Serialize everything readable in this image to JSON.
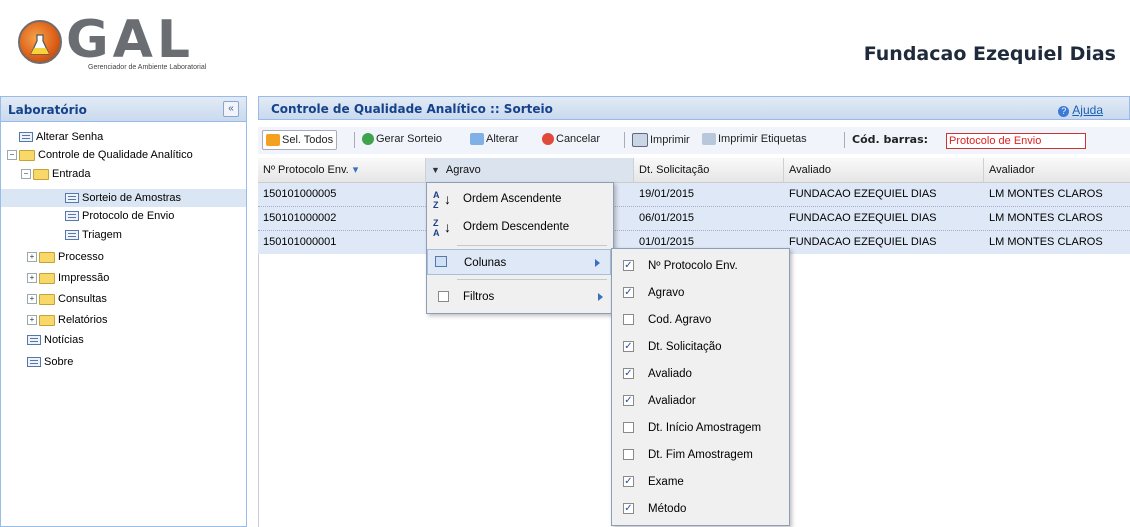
{
  "header": {
    "logo_text": "GAL",
    "logo_subtitle": "Gerenciador de Ambiente Laboratorial",
    "org_title": "Fundacao Ezequiel Dias"
  },
  "left_panel": {
    "title": "Laboratório",
    "collapse_glyph": "«",
    "items": [
      {
        "label": "Alterar Senha"
      },
      {
        "label": "Controle de Qualidade Analítico"
      },
      {
        "label": "Entrada"
      },
      {
        "label": "Sorteio de Amostras"
      },
      {
        "label": "Protocolo de Envio"
      },
      {
        "label": "Triagem"
      },
      {
        "label": "Processo"
      },
      {
        "label": "Impressão"
      },
      {
        "label": "Consultas"
      },
      {
        "label": "Relatórios"
      },
      {
        "label": "Notícias"
      },
      {
        "label": "Sobre"
      }
    ]
  },
  "main": {
    "title": "Controle de Qualidade Analítico :: Sorteio",
    "help_label": "Ajuda"
  },
  "toolbar": {
    "select_all": "Sel. Todos",
    "generate": "Gerar Sorteio",
    "edit": "Alterar",
    "cancel": "Cancelar",
    "print": "Imprimir",
    "print_labels": "Imprimir Etiquetas",
    "barcode_label": "Cód. barras:",
    "barcode_value": "Protocolo de Envio"
  },
  "grid": {
    "columns": [
      "Nº Protocolo Env.",
      "Agravo",
      "Dt. Solicitação",
      "Avaliado",
      "Avaliador"
    ],
    "rows": [
      {
        "protocolo": "150101000005",
        "agravo": "",
        "data": "19/01/2015",
        "avaliado": "FUNDACAO EZEQUIEL DIAS",
        "avaliador": "LM MONTES CLAROS"
      },
      {
        "protocolo": "150101000002",
        "agravo": "",
        "data": "06/01/2015",
        "avaliado": "FUNDACAO EZEQUIEL DIAS",
        "avaliador": "LM MONTES CLAROS"
      },
      {
        "protocolo": "150101000001",
        "agravo": "",
        "data": "01/01/2015",
        "avaliado": "FUNDACAO EZEQUIEL DIAS",
        "avaliador": "LM MONTES CLAROS"
      }
    ]
  },
  "column_menu": {
    "sort_asc": "Ordem Ascendente",
    "sort_desc": "Ordem Descendente",
    "columns": "Colunas",
    "filters": "Filtros"
  },
  "columns_submenu": {
    "items": [
      {
        "label": "Nº Protocolo Env.",
        "checked": true
      },
      {
        "label": "Agravo",
        "checked": true
      },
      {
        "label": "Cod. Agravo",
        "checked": false
      },
      {
        "label": "Dt. Solicitação",
        "checked": true
      },
      {
        "label": "Avaliado",
        "checked": true
      },
      {
        "label": "Avaliador",
        "checked": true
      },
      {
        "label": "Dt. Início Amostragem",
        "checked": false
      },
      {
        "label": "Dt. Fim Amostragem",
        "checked": false
      },
      {
        "label": "Exame",
        "checked": true
      },
      {
        "label": "Método",
        "checked": true
      }
    ]
  }
}
